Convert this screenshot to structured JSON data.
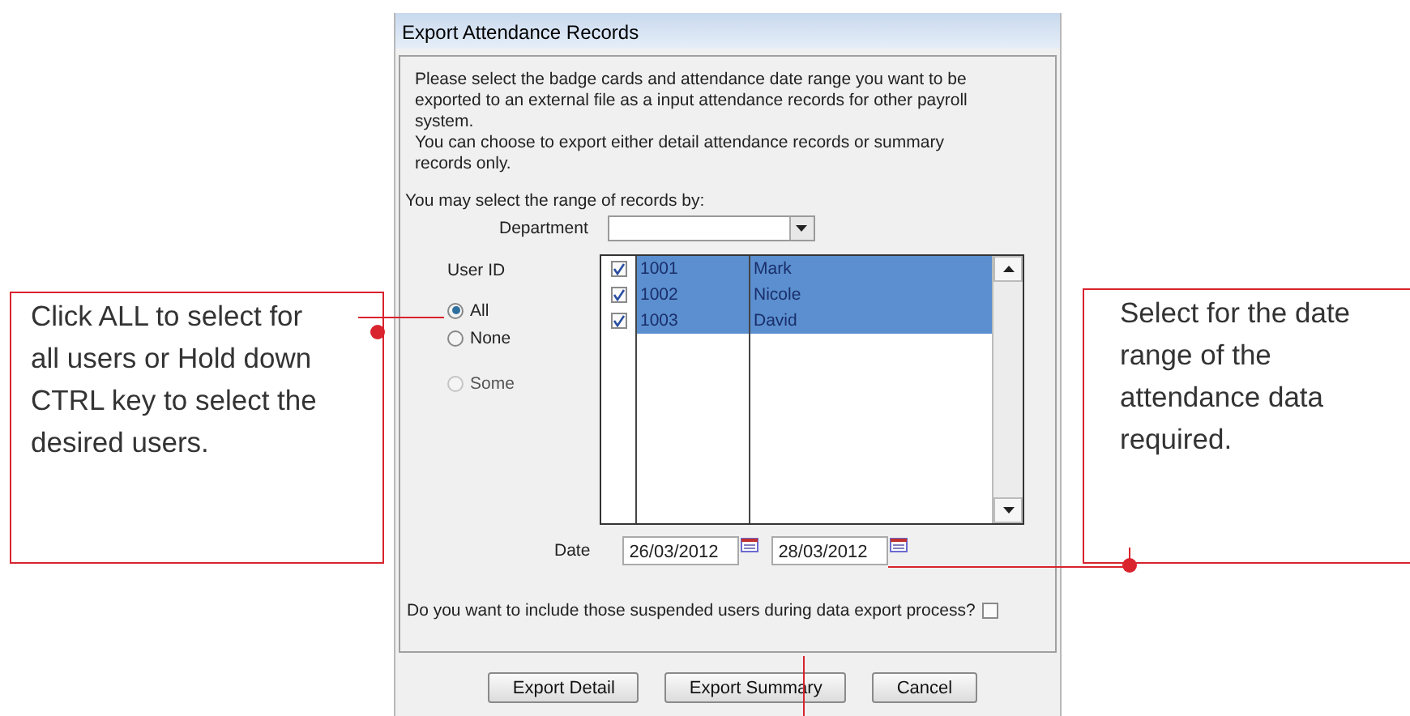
{
  "window": {
    "title": "Export Attendance Records"
  },
  "intro": [
    "Please select the badge cards and attendance date range you want to be exported to an external file as a input attendance records for other payroll system.",
    "You can choose to export either detail attendance records or summary records only."
  ],
  "range_label": "You may select the range of records by:",
  "department": {
    "label": "Department"
  },
  "user_id": {
    "label": "User ID",
    "options": [
      {
        "label": "All",
        "selected": true,
        "disabled": false
      },
      {
        "label": "None",
        "selected": false,
        "disabled": false
      },
      {
        "label": "Some",
        "selected": false,
        "disabled": true
      }
    ]
  },
  "users": [
    {
      "id": "1001",
      "name": "Mark",
      "checked": true,
      "selected": true
    },
    {
      "id": "1002",
      "name": "Nicole",
      "checked": true,
      "selected": true
    },
    {
      "id": "1003",
      "name": "David",
      "checked": true,
      "selected": true
    }
  ],
  "date": {
    "label": "Date",
    "from": "26/03/2012",
    "to": "28/03/2012"
  },
  "suspended": {
    "label": "Do you want to include those suspended users during data export process?",
    "checked": false
  },
  "buttons": [
    "Export Detail",
    "Export Summary",
    "Cancel"
  ],
  "callouts": [
    {
      "text": "Click ALL to select for all users or Hold down CTRL key to select the desired users."
    },
    {
      "text": "Select for the date range of the attendance data required."
    }
  ]
}
